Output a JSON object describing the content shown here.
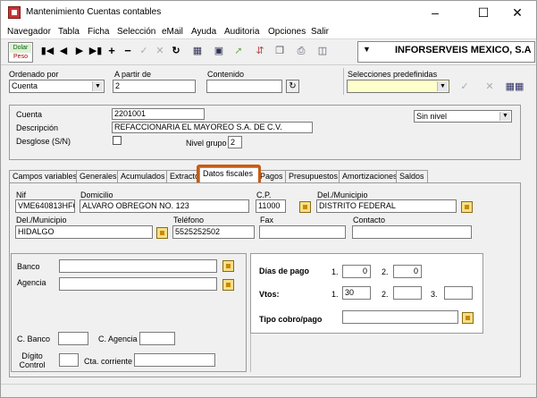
{
  "window": {
    "title": "Mantenimiento Cuentas contables"
  },
  "menu": [
    "Navegador",
    "Tabla",
    "Ficha",
    "Selección",
    "eMail",
    "Ayuda",
    "Auditoria",
    "Opciones",
    "Salir"
  ],
  "toolbar": {
    "dolar_label": "Dolar",
    "peso_label": "Peso",
    "company": "INFORSERVEIS MEXICO, S.A"
  },
  "filters": {
    "ordenado_label": "Ordenado por",
    "ordenado_value": "Cuenta",
    "apartir_label": "A partir de",
    "apartir_value": "2",
    "contenido_label": "Contenido",
    "contenido_value": "",
    "selecciones_label": "Selecciones predefinidas",
    "selecciones_value": ""
  },
  "account": {
    "cuenta_label": "Cuenta",
    "cuenta_value": "2201001",
    "descripcion_label": "Descripción",
    "descripcion_value": "REFACCIONARIA EL MAYOREO S.A. DE C.V.",
    "desglose_label": "Desglose (S/N)",
    "nivel_label": "Nivel grupo",
    "nivel_value": "2",
    "nivel_select": "Sin nivel"
  },
  "tabs": [
    "Campos variables",
    "Generales",
    "Acumulados",
    "Extractos",
    "Datos fiscales",
    "Pagos",
    "Presupuestos",
    "Amortizaciones",
    "Saldos"
  ],
  "fiscal": {
    "nif_label": "Nif",
    "nif_value": "VME640813HF6",
    "domicilio_label": "Domicilio",
    "domicilio_value": "ALVARO OBREGON NO. 123",
    "cp_label": "C.P.",
    "cp_value": "11000",
    "delmun1_label": "Del./Municipio",
    "delmun1_value": "DISTRITO FEDERAL",
    "delmun2_label": "Del./Municipio",
    "delmun2_value": "HIDALGO",
    "telefono_label": "Teléfono",
    "telefono_value": "5525252502",
    "fax_label": "Fax",
    "fax_value": "",
    "contacto_label": "Contacto",
    "contacto_value": ""
  },
  "bank": {
    "banco_label": "Banco",
    "agencia_label": "Agencia",
    "cbanco_label": "C. Banco",
    "cagencia_label": "C. Agencia",
    "digito_label": "Dígito Control",
    "cta_label": "Cta. corriente"
  },
  "payment": {
    "dias_label": "Días de pago",
    "dias_1_num": "1.",
    "dias_1_value": "0",
    "dias_2_num": "2.",
    "dias_2_value": "0",
    "vtos_label": "Vtos:",
    "vtos_1_num": "1.",
    "vtos_1_value": "30",
    "vtos_2_num": "2.",
    "vtos_2_value": "",
    "vtos_3_num": "3.",
    "vtos_3_value": "",
    "tipo_label": "Tipo cobro/pago",
    "tipo_value": ""
  }
}
